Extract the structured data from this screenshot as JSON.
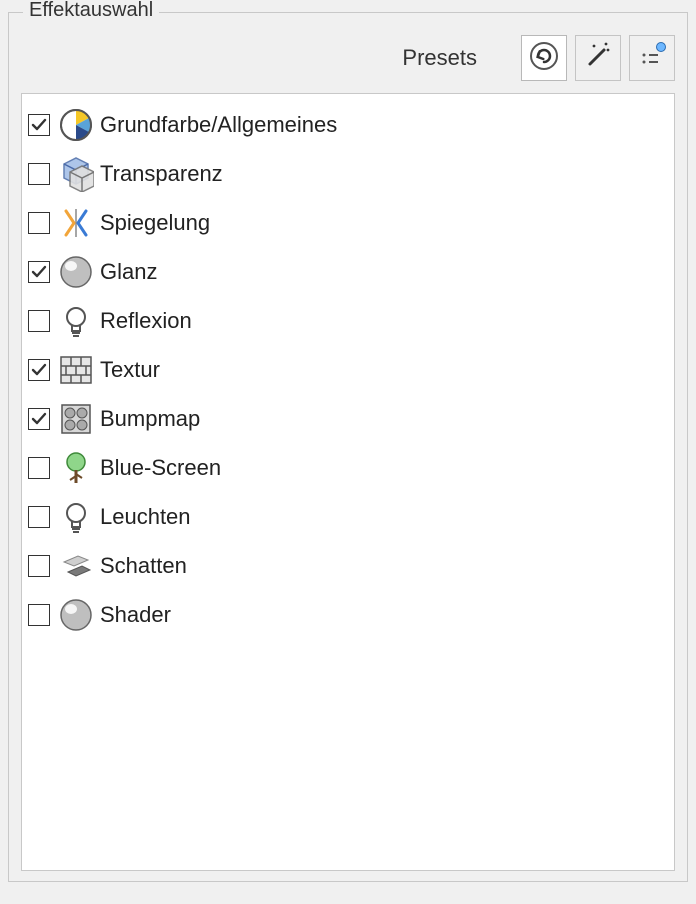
{
  "panel": {
    "title": "Effektauswahl",
    "presets_label": "Presets"
  },
  "effects": [
    {
      "checked": true,
      "label": "Grundfarbe/Allgemeines",
      "icon": "color-wheel"
    },
    {
      "checked": false,
      "label": "Transparenz",
      "icon": "transparency"
    },
    {
      "checked": false,
      "label": "Spiegelung",
      "icon": "mirror"
    },
    {
      "checked": true,
      "label": "Glanz",
      "icon": "gloss-sphere"
    },
    {
      "checked": false,
      "label": "Reflexion",
      "icon": "bulb"
    },
    {
      "checked": true,
      "label": "Textur",
      "icon": "brick"
    },
    {
      "checked": true,
      "label": "Bumpmap",
      "icon": "bump"
    },
    {
      "checked": false,
      "label": "Blue-Screen",
      "icon": "tree"
    },
    {
      "checked": false,
      "label": "Leuchten",
      "icon": "bulb"
    },
    {
      "checked": false,
      "label": "Schatten",
      "icon": "shadow"
    },
    {
      "checked": false,
      "label": "Shader",
      "icon": "gloss-sphere"
    }
  ]
}
